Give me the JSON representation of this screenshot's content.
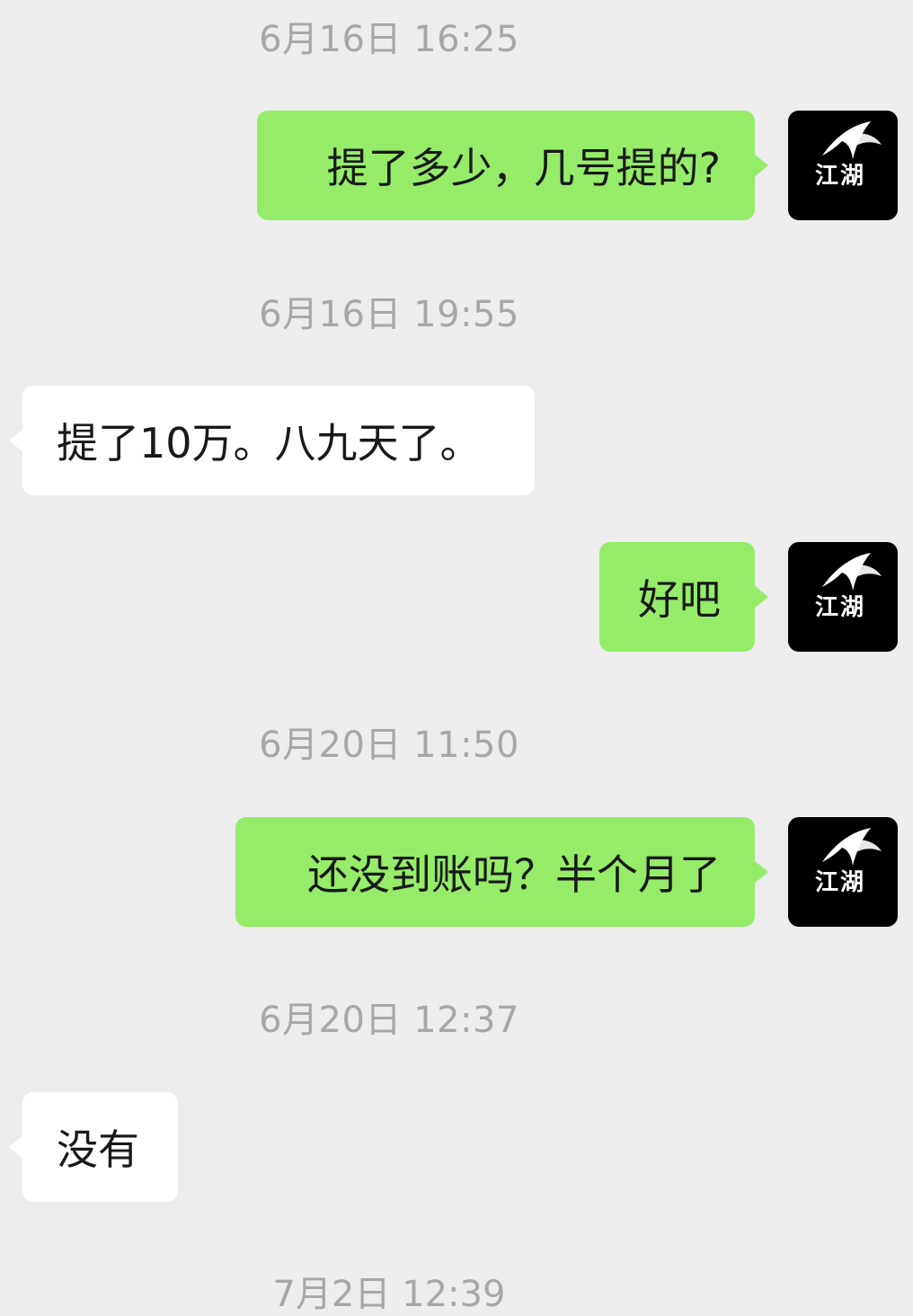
{
  "chat": {
    "avatar_icon": "ink-brush-calligraphy-avatar",
    "avatar_text": "江湖",
    "colors": {
      "background": "#ededed",
      "outgoing_bubble": "#95ec69",
      "incoming_bubble": "#ffffff",
      "timestamp_text": "#a7a7a7",
      "message_text": "#191919"
    },
    "messages": [
      {
        "timestamp": "6月16日 16:25",
        "direction": "outgoing",
        "text": "提了多少，几号提的?"
      },
      {
        "timestamp": "6月16日 19:55",
        "direction": "incoming",
        "text": "提了10万。八九天了。"
      },
      {
        "direction": "outgoing",
        "text": "好吧"
      },
      {
        "timestamp": "6月20日 11:50",
        "direction": "outgoing",
        "text": "还没到账吗？半个月了"
      },
      {
        "timestamp": "6月20日 12:37",
        "direction": "incoming",
        "text": "没有"
      },
      {
        "timestamp": "7月2日 12:39"
      }
    ]
  }
}
